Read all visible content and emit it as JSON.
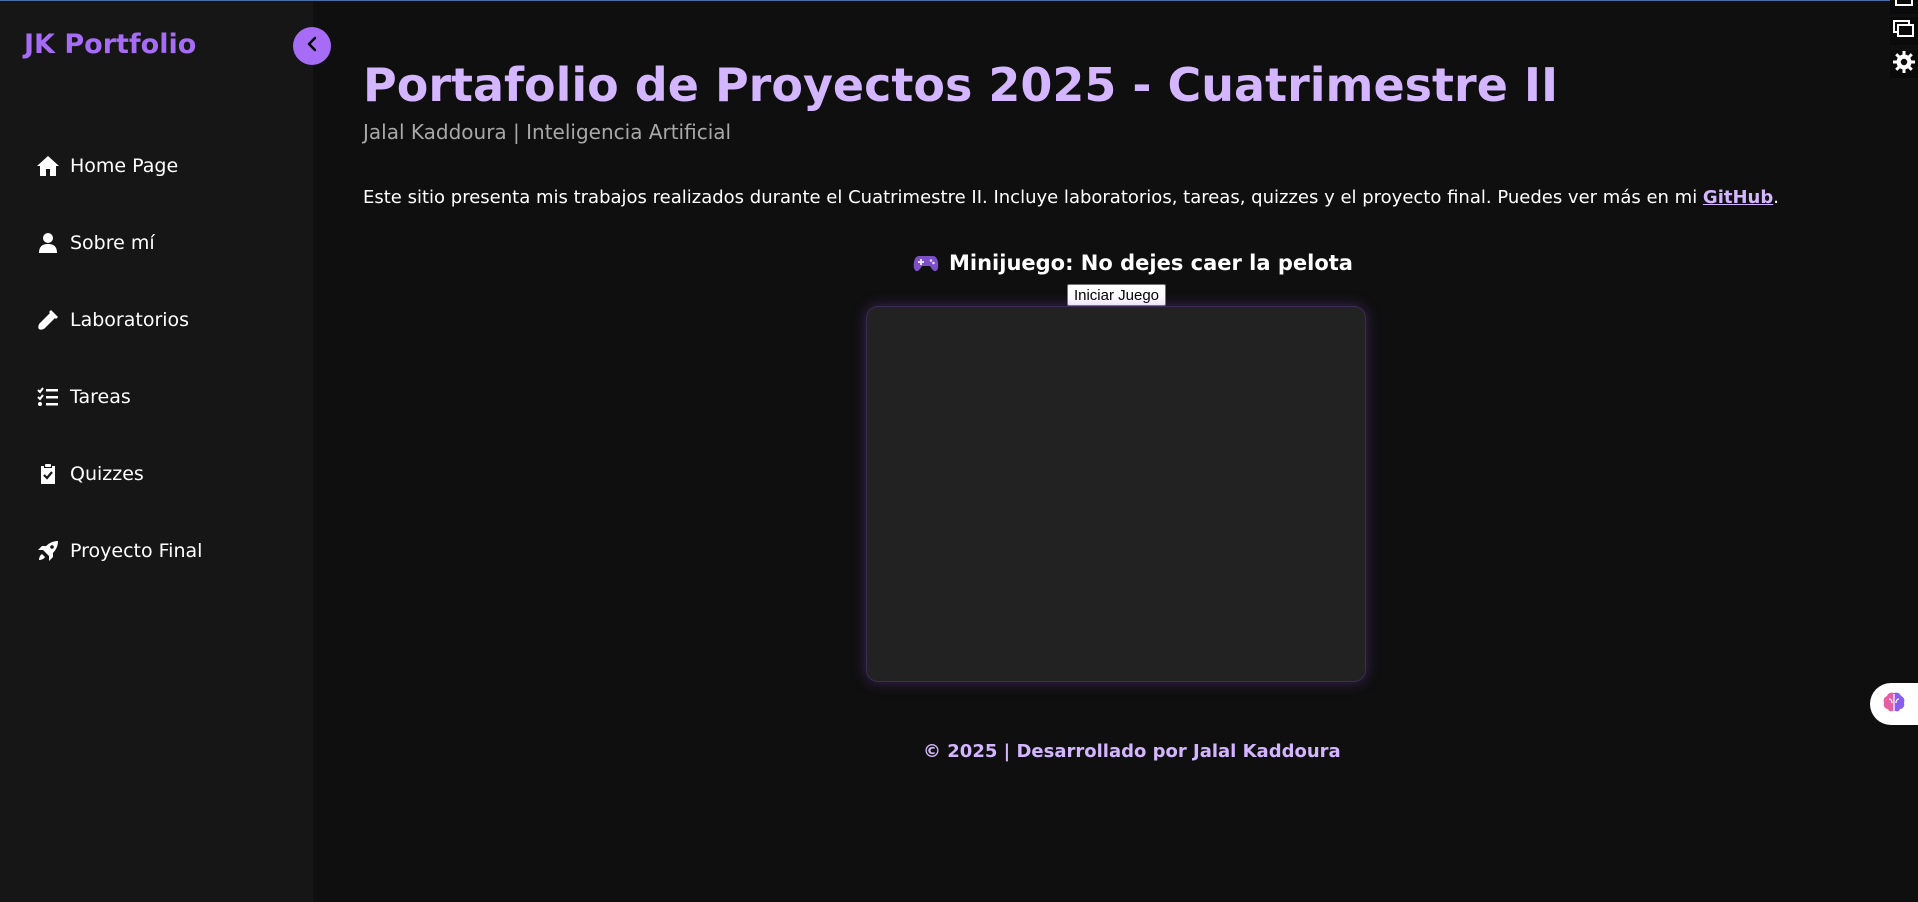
{
  "sidebar": {
    "brand": "JK Portfolio",
    "items": [
      {
        "label": "Home Page",
        "icon": "home-icon"
      },
      {
        "label": "Sobre mí",
        "icon": "user-icon"
      },
      {
        "label": "Laboratorios",
        "icon": "flask-icon"
      },
      {
        "label": "Tareas",
        "icon": "checklist-icon"
      },
      {
        "label": "Quizzes",
        "icon": "clipboard-check-icon"
      },
      {
        "label": "Proyecto Final",
        "icon": "rocket-icon"
      }
    ]
  },
  "header": {
    "title": "Portafolio de Proyectos 2025 - Cuatrimestre II",
    "subtitle": "Jalal Kaddoura | Inteligencia Artificial"
  },
  "intro": {
    "text": "Este sitio presenta mis trabajos realizados durante el Cuatrimestre II. Incluye laboratorios, tareas, quizzes y el proyecto final. Puedes ver más en mi ",
    "link_label": "GitHub",
    "end": "."
  },
  "game": {
    "title": "Minijuego: No dejes caer la pelota",
    "start_label": "Iniciar Juego"
  },
  "footer": {
    "text": "© 2025 | Desarrollado por Jalal Kaddoura"
  },
  "colors": {
    "accent": "#a66cf5",
    "heading": "#d4b5ff",
    "background": "#0f0f0f",
    "sidebar": "#161616",
    "canvas": "#222222"
  }
}
